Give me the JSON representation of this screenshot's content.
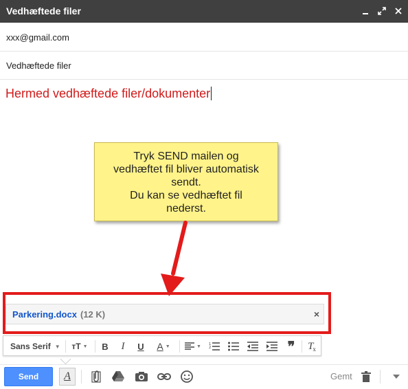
{
  "window": {
    "title": "Vedhæftede filer",
    "minimize_icon": "minimize-icon",
    "popout_icon": "popout-icon",
    "close_icon": "close-icon"
  },
  "compose": {
    "to": "xxx@gmail.com",
    "subject": "Vedhæftede filer",
    "body": "Hermed vedhæftede filer/dokumenter",
    "body_color": "#d01a1a"
  },
  "annotation": {
    "lines": [
      "Tryk SEND mailen og",
      "vedhæftet fil bliver automatisk",
      "sendt.",
      "Du kan se vedhæftet fil",
      "nederst."
    ],
    "note_color": "#fff38a",
    "highlight_color": "#e31b1b"
  },
  "attachment": {
    "name": "Parkering.docx",
    "size": "(12 K)",
    "remove_icon": "close-icon"
  },
  "format_bar": {
    "font": "Sans Serif",
    "items": [
      "font-size-icon",
      "bold-icon",
      "italic-icon",
      "underline-icon",
      "text-color-icon",
      "align-icon",
      "numbered-list-icon",
      "bulleted-list-icon",
      "indent-less-icon",
      "indent-more-icon",
      "quote-icon",
      "remove-formatting-icon"
    ]
  },
  "bottom_bar": {
    "send_label": "Send",
    "saved_label": "Gemt",
    "send_color": "#4d90fe",
    "icons": [
      "formatting-icon",
      "attach-icon",
      "drive-icon",
      "photo-icon",
      "link-icon",
      "emoji-icon",
      "trash-icon",
      "more-options-icon"
    ]
  }
}
